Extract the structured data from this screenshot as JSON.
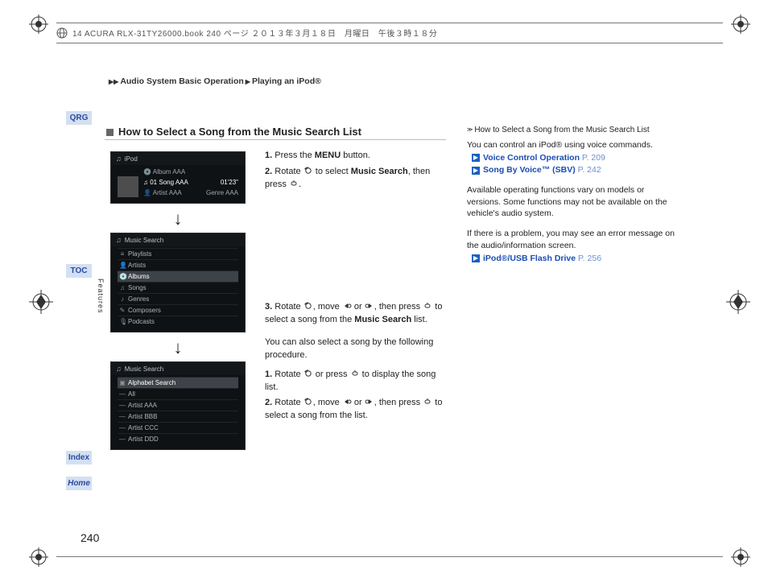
{
  "header": {
    "file_line": "14 ACURA RLX-31TY26000.book  240 ページ  ２０１３年３月１８日　月曜日　午後３時１８分"
  },
  "breadcrumb": {
    "a": "Audio System Basic Operation",
    "b": "Playing an iPod®"
  },
  "tabs": {
    "qrg": "QRG",
    "toc": "TOC",
    "features": "Features",
    "index": "Index",
    "home": "Home"
  },
  "section": {
    "title": "How to Select a Song from the Music Search List"
  },
  "screens": {
    "s1": {
      "title": "iPod",
      "line1": "Album AAA",
      "line2": "01 Song AAA",
      "time": "01'23\"",
      "line3": "Artist AAA",
      "genre": "Genre AAA"
    },
    "s2": {
      "title": "Music Search",
      "items": [
        "Playlists",
        "Artists",
        "Albums",
        "Songs",
        "Genres",
        "Composers",
        "Podcasts"
      ],
      "selected": 2
    },
    "s3": {
      "title": "Music Search",
      "items": [
        "Alphabet Search",
        "All",
        "Artist AAA",
        "Artist BBB",
        "Artist CCC",
        "Artist DDD"
      ],
      "selected": 0
    }
  },
  "instr": {
    "s1": {
      "pre": "Press the ",
      "bold": "MENU",
      "post": " button."
    },
    "s2": {
      "preA": "Rotate ",
      "mid": " to select ",
      "bold": "Music Search",
      "post": ", then press ",
      "post2": "."
    },
    "s3": {
      "a": "Rotate ",
      "b": ", move ",
      "or": " or ",
      "c": ", then press ",
      "d": " to select a song from the ",
      "bold": "Music Search",
      "e": " list."
    },
    "also": "You can also select a song by the following procedure.",
    "s4": {
      "a": "Rotate ",
      "b": " or press ",
      "c": " to display the song list."
    },
    "s5": {
      "a": "Rotate ",
      "b": ", move ",
      "or": " or ",
      "c": ", then press ",
      "d": " to select a song from the list."
    },
    "n1": "1.",
    "n2": "2.",
    "n3": "3."
  },
  "notes": {
    "head": "How to Select a Song from the Music Search List",
    "p1": "You can control an iPod® using voice commands.",
    "link1": {
      "label": "Voice Control Operation",
      "page": "P. 209"
    },
    "link2": {
      "label": "Song By Voice™ (SBV)",
      "page": "P. 242"
    },
    "p2": "Available operating functions vary on models or versions. Some functions may not be available on the vehicle's audio system.",
    "p3": "If there is a problem, you may see an error message on the audio/information screen.",
    "link3": {
      "label": "iPod®/USB Flash Drive",
      "page": "P. 256"
    }
  },
  "page_no": "240"
}
